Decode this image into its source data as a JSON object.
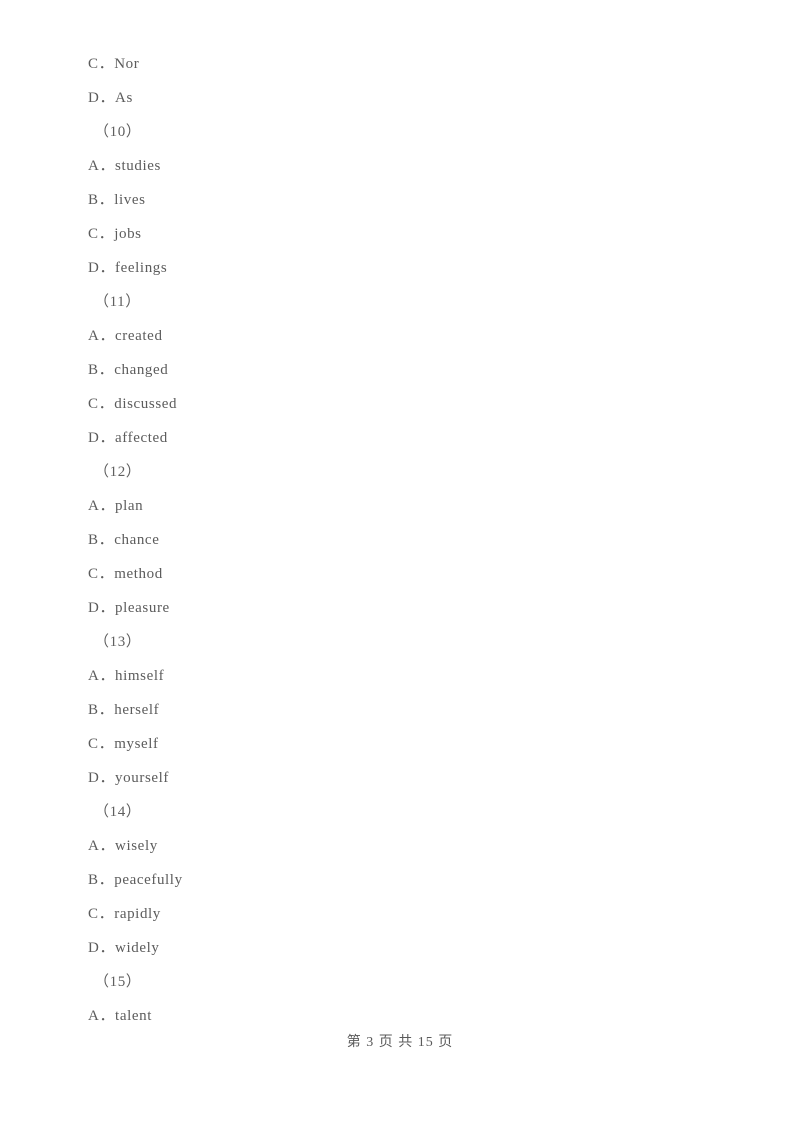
{
  "document": {
    "page_background": "#ffffff",
    "text_color": "#5c5c5c"
  },
  "content_lines": [
    {
      "kind": "option",
      "letter": "C",
      "sep": "．",
      "text": "Nor"
    },
    {
      "kind": "option",
      "letter": "D",
      "sep": "．",
      "text": "As"
    },
    {
      "kind": "qnum",
      "label": "（10）"
    },
    {
      "kind": "option",
      "letter": "A",
      "sep": "．",
      "text": "studies"
    },
    {
      "kind": "option",
      "letter": "B",
      "sep": "．",
      "text": "lives"
    },
    {
      "kind": "option",
      "letter": "C",
      "sep": "．",
      "text": "jobs"
    },
    {
      "kind": "option",
      "letter": "D",
      "sep": "．",
      "text": "feelings"
    },
    {
      "kind": "qnum",
      "label": "（11）"
    },
    {
      "kind": "option",
      "letter": "A",
      "sep": "．",
      "text": "created"
    },
    {
      "kind": "option",
      "letter": "B",
      "sep": "．",
      "text": "changed"
    },
    {
      "kind": "option",
      "letter": "C",
      "sep": "．",
      "text": "discussed"
    },
    {
      "kind": "option",
      "letter": "D",
      "sep": "．",
      "text": "affected"
    },
    {
      "kind": "qnum",
      "label": "（12）"
    },
    {
      "kind": "option",
      "letter": "A",
      "sep": "．",
      "text": "plan"
    },
    {
      "kind": "option",
      "letter": "B",
      "sep": "．",
      "text": "chance"
    },
    {
      "kind": "option",
      "letter": "C",
      "sep": "．",
      "text": "method"
    },
    {
      "kind": "option",
      "letter": "D",
      "sep": "．",
      "text": "pleasure"
    },
    {
      "kind": "qnum",
      "label": "（13）"
    },
    {
      "kind": "option",
      "letter": "A",
      "sep": "．",
      "text": "himself"
    },
    {
      "kind": "option",
      "letter": "B",
      "sep": "．",
      "text": "herself"
    },
    {
      "kind": "option",
      "letter": "C",
      "sep": "．",
      "text": "myself"
    },
    {
      "kind": "option",
      "letter": "D",
      "sep": "．",
      "text": "yourself"
    },
    {
      "kind": "qnum",
      "label": "（14）"
    },
    {
      "kind": "option",
      "letter": "A",
      "sep": "．",
      "text": "wisely"
    },
    {
      "kind": "option",
      "letter": "B",
      "sep": "．",
      "text": "peacefully"
    },
    {
      "kind": "option",
      "letter": "C",
      "sep": "．",
      "text": "rapidly"
    },
    {
      "kind": "option",
      "letter": "D",
      "sep": "．",
      "text": "widely"
    },
    {
      "kind": "qnum",
      "label": "（15）"
    },
    {
      "kind": "option",
      "letter": "A",
      "sep": "．",
      "text": "talent"
    }
  ],
  "footer": {
    "text": "第 3 页 共 15 页",
    "current_page": "3",
    "total_pages": "15"
  }
}
